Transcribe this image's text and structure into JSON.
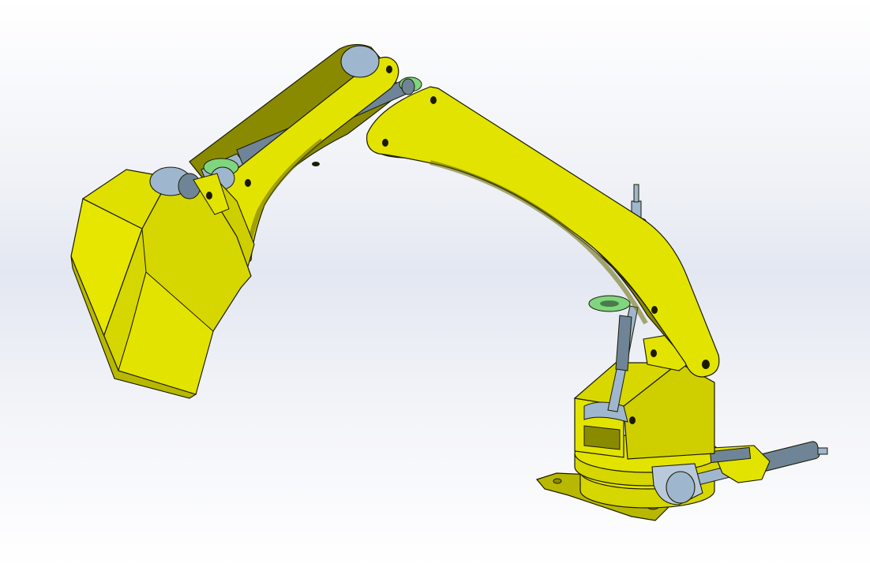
{
  "scene": {
    "subject": "cad-excavator-arm-assembly",
    "colors": {
      "yellow_light": "#e6e600",
      "yellow_mid": "#cfcf00",
      "yellow_shadow": "#8a8a00",
      "steel_blue": "#9fb6cf",
      "steel_dark": "#6f8597",
      "green_ring": "#7fd67f",
      "outline": "#1a1a00"
    },
    "icons": [
      "bucket",
      "stick-arm",
      "boom-arm",
      "hydraulic-cylinder",
      "pivot-pin",
      "turntable-base"
    ]
  }
}
